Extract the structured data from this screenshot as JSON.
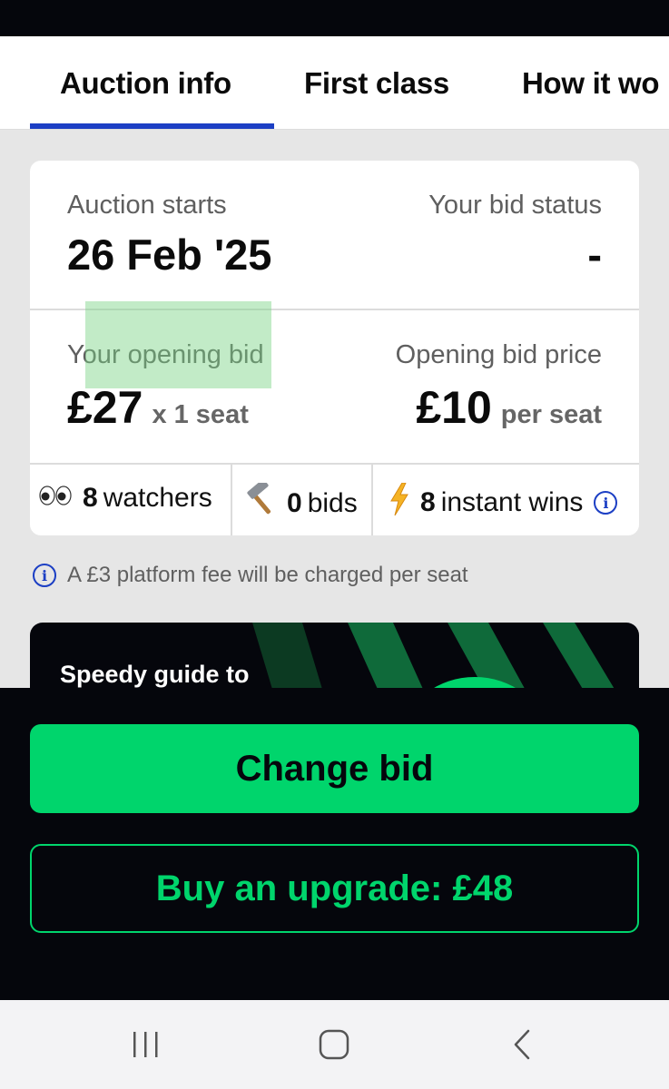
{
  "tabs": [
    {
      "label": "Auction info",
      "active": true
    },
    {
      "label": "First class",
      "active": false
    },
    {
      "label": "How it wo",
      "active": false
    }
  ],
  "auction_card": {
    "starts_label": "Auction starts",
    "starts_value": "26 Feb '25",
    "status_label": "Your bid status",
    "status_value": "-",
    "opening_bid_label": "Your opening bid",
    "opening_bid_value": "£27",
    "opening_bid_qty": "x 1 seat",
    "price_label": "Opening bid price",
    "price_value": "£10",
    "price_unit": "per seat"
  },
  "stats": {
    "watchers": {
      "icon": "eyes-icon",
      "count": "8",
      "label": "watchers"
    },
    "bids": {
      "icon": "hammer-icon",
      "count": "0",
      "label": "bids"
    },
    "instant_wins": {
      "icon": "lightning-icon",
      "count": "8",
      "label": "instant wins"
    }
  },
  "fee_note": "A £3 platform fee will be charged per seat",
  "guide": {
    "title": "Speedy guide to"
  },
  "actions": {
    "change_bid": "Change bid",
    "buy_upgrade": "Buy an upgrade: £48"
  },
  "colors": {
    "accent_green": "#00d56c",
    "accent_blue": "#1c3fc4",
    "dark": "#05060c"
  }
}
